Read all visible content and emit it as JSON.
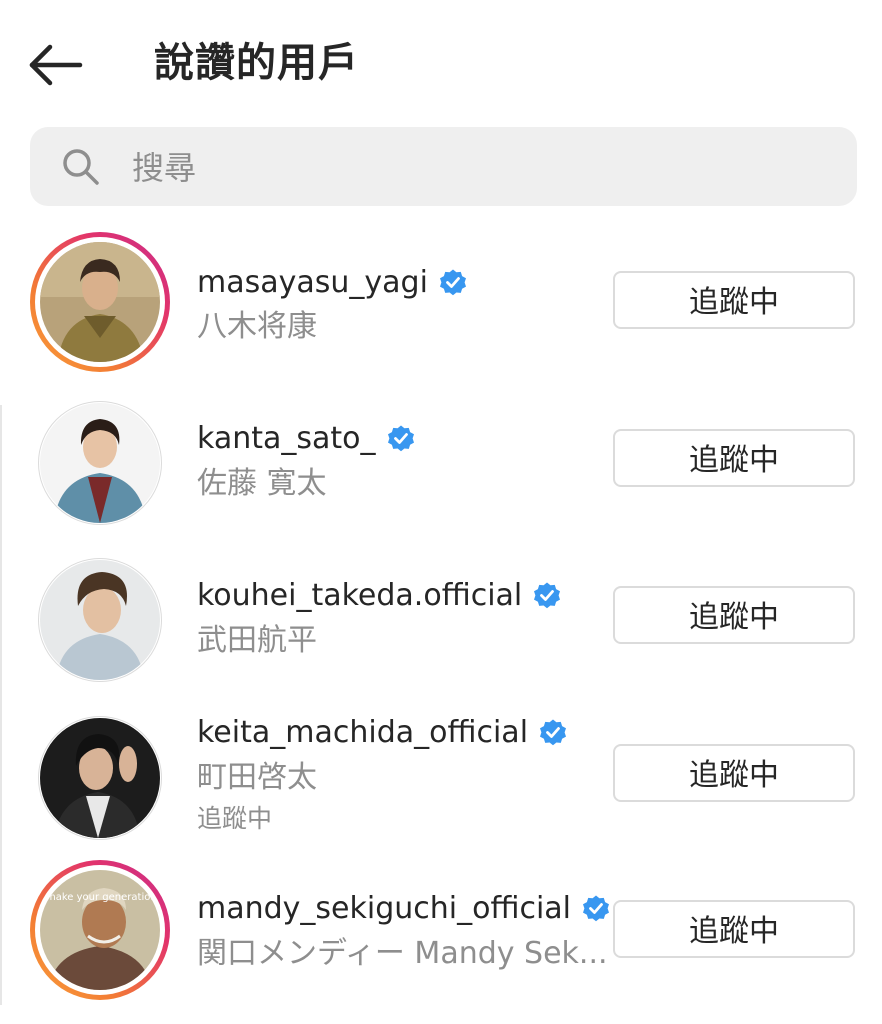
{
  "header": {
    "title": "說讚的用戶",
    "back_icon": "arrow-left-icon"
  },
  "search": {
    "placeholder": "搜尋",
    "value": "",
    "icon": "search-icon"
  },
  "verified_color": "#3897f0",
  "users": [
    {
      "username": "masayasu_yagi",
      "full_name": "八木将康",
      "subtitle": "",
      "verified": true,
      "story_ring": true,
      "button_label": "追蹤中",
      "avatar_palette": {
        "bg": "#b8a27a",
        "skin": "#d9b08c",
        "hair": "#3a2a1f",
        "cloth": "#8f7a3e"
      }
    },
    {
      "username": "kanta_sato_",
      "full_name": "佐藤 寛太",
      "subtitle": "",
      "verified": true,
      "story_ring": false,
      "button_label": "追蹤中",
      "avatar_palette": {
        "bg": "#f4f4f4",
        "skin": "#e7c3a5",
        "hair": "#2a1d17",
        "cloth": "#5f8fa8"
      }
    },
    {
      "username": "kouhei_takeda.official",
      "full_name": "武田航平",
      "subtitle": "",
      "verified": true,
      "story_ring": false,
      "button_label": "追蹤中",
      "avatar_palette": {
        "bg": "#e7e9ea",
        "skin": "#e3c0a2",
        "hair": "#4a3524",
        "cloth": "#b9c7d2"
      }
    },
    {
      "username": "keita_machida_official",
      "full_name": "町田啓太",
      "subtitle": "追蹤中",
      "verified": true,
      "story_ring": false,
      "button_label": "追蹤中",
      "avatar_palette": {
        "bg": "#1c1c1c",
        "skin": "#d8b397",
        "hair": "#111111",
        "cloth": "#e8e8e8"
      }
    },
    {
      "username": "mandy_sekiguchi_official",
      "full_name": "関口メンディー Mandy Sek...",
      "subtitle": "",
      "verified": true,
      "story_ring": true,
      "button_label": "追蹤中",
      "avatar_text": "make your generation",
      "avatar_palette": {
        "bg": "#c9bfa3",
        "skin": "#b07a52",
        "hair": "#2a1d15",
        "cloth": "#6b4a3a"
      }
    }
  ]
}
